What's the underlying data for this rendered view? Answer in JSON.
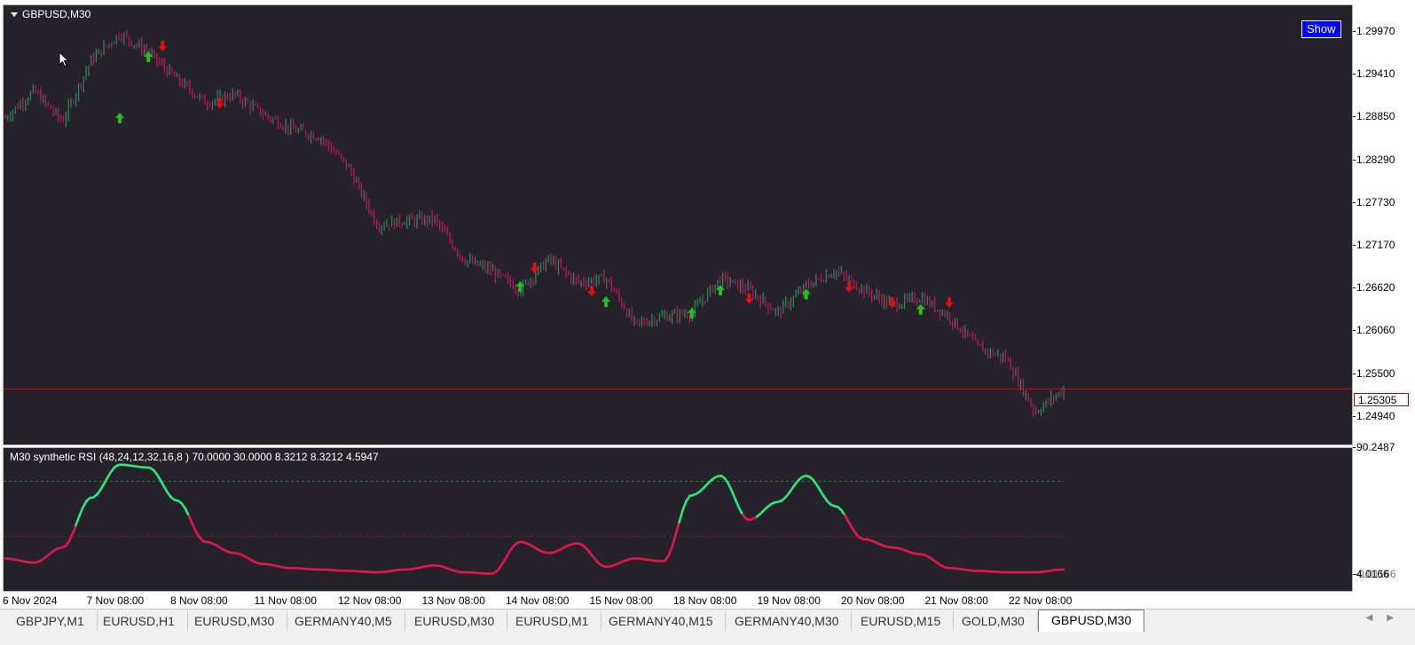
{
  "window": {
    "symbol_title": "GBPUSD,M30",
    "show_button": "Show"
  },
  "price_scale": {
    "labels": [
      "1.29970",
      "1.29410",
      "1.28850",
      "1.28290",
      "1.27730",
      "1.27170",
      "1.26620",
      "1.26060",
      "1.25500",
      "1.24940"
    ],
    "current_price": "1.25305"
  },
  "indicator": {
    "label": "M30 synthetic RSI  (48,24,12,32,16,8 ) 70.0000 30.0000 8.3212 8.3212 4.5947",
    "scale_top": "90.2487",
    "scale_bottom": "4.0166",
    "scale_bottom_overlap": "0.01166",
    "levels": [
      70,
      30
    ]
  },
  "time_axis": {
    "labels": [
      "6 Nov 2024",
      "7 Nov 08:00",
      "8 Nov 08:00",
      "11 Nov 08:00",
      "12 Nov 08:00",
      "13 Nov 08:00",
      "14 Nov 08:00",
      "15 Nov 08:00",
      "18 Nov 08:00",
      "19 Nov 08:00",
      "20 Nov 08:00",
      "21 Nov 08:00",
      "22 Nov 08:00"
    ]
  },
  "tabs": [
    {
      "label": "GBPJPY,M1",
      "active": false
    },
    {
      "label": "EURUSD,H1",
      "active": false
    },
    {
      "label": "EURUSD,M30",
      "active": false
    },
    {
      "label": "GERMANY40,M5",
      "active": false
    },
    {
      "label": "EURUSD,M30",
      "active": false
    },
    {
      "label": "EURUSD,M1",
      "active": false
    },
    {
      "label": "GERMANY40,M15",
      "active": false
    },
    {
      "label": "GERMANY40,M30",
      "active": false
    },
    {
      "label": "EURUSD,M15",
      "active": false
    },
    {
      "label": "GOLD,M30",
      "active": false
    },
    {
      "label": "GBPUSD,M30",
      "active": true
    }
  ],
  "colors": {
    "background": "#26222c",
    "bull": "#2e8b57",
    "bear": "#c2185b",
    "buy_arrow": "#22c022",
    "sell_arrow": "#e01010",
    "rsi_high": "#2ee87a",
    "rsi_low": "#e0174f",
    "price_line": "#e00000"
  },
  "icons": [
    "chevron-down-icon",
    "mouse-cursor-icon",
    "scroll-left-icon",
    "scroll-right-icon",
    "buy-arrow-icon",
    "sell-arrow-icon"
  ],
  "chart_data": {
    "type": "line",
    "symbol": "GBPUSD",
    "timeframe": "M30",
    "x": [
      "6 Nov",
      "6 Nov 12:00",
      "7 Nov 00:00",
      "7 Nov 08:00",
      "7 Nov 16:00",
      "8 Nov 00:00",
      "8 Nov 08:00",
      "8 Nov 16:00",
      "11 Nov 00:00",
      "11 Nov 08:00",
      "11 Nov 16:00",
      "12 Nov 00:00",
      "12 Nov 08:00",
      "12 Nov 16:00",
      "13 Nov 00:00",
      "13 Nov 08:00",
      "13 Nov 16:00",
      "14 Nov 00:00",
      "14 Nov 08:00",
      "14 Nov 16:00",
      "15 Nov 00:00",
      "15 Nov 08:00",
      "15 Nov 16:00",
      "18 Nov 00:00",
      "18 Nov 08:00",
      "18 Nov 16:00",
      "19 Nov 00:00",
      "19 Nov 08:00",
      "19 Nov 16:00",
      "20 Nov 00:00",
      "20 Nov 08:00",
      "20 Nov 16:00",
      "21 Nov 00:00",
      "21 Nov 08:00",
      "21 Nov 16:00",
      "22 Nov 00:00",
      "22 Nov 08:00",
      "22 Nov 12:00"
    ],
    "price": [
      1.2885,
      1.292,
      1.288,
      1.296,
      1.2995,
      1.297,
      1.2935,
      1.2905,
      1.2915,
      1.289,
      1.287,
      1.286,
      1.282,
      1.2745,
      1.275,
      1.2752,
      1.27,
      1.2685,
      1.266,
      1.27,
      1.267,
      1.2675,
      1.2615,
      1.2625,
      1.263,
      1.2675,
      1.266,
      1.263,
      1.2665,
      1.2685,
      1.266,
      1.264,
      1.265,
      1.2625,
      1.2585,
      1.257,
      1.25,
      1.253
    ],
    "rsi": [
      14,
      11,
      22,
      58,
      82,
      80,
      56,
      26,
      18,
      10,
      7,
      6,
      5,
      4,
      6,
      9,
      4,
      3,
      26,
      18,
      25,
      8,
      14,
      12,
      60,
      74,
      42,
      55,
      74,
      52,
      28,
      22,
      17,
      7,
      5,
      4,
      4,
      6
    ],
    "ylim_price": [
      1.248,
      1.3007
    ],
    "ylim_rsi": [
      4.0166,
      90.2487
    ],
    "grid": false,
    "buy_signals": [
      1.2895,
      1.2975,
      1.2675,
      1.2655,
      1.264,
      1.267,
      1.2665,
      1.2645
    ],
    "sell_signals": [
      1.2975,
      1.29,
      1.2685,
      1.2655,
      1.2645,
      1.266,
      1.264,
      1.264
    ]
  }
}
